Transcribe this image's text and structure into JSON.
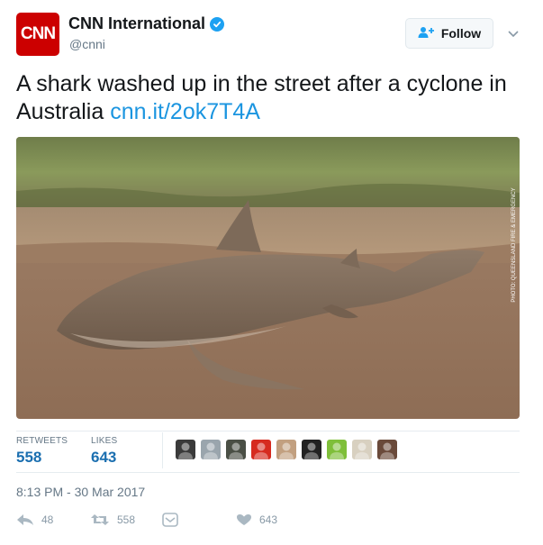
{
  "account": {
    "avatar_text": "CNN",
    "display_name": "CNN International",
    "handle": "@cnni",
    "verified_color": "#1da1f2",
    "brand_color": "#cc0000"
  },
  "follow": {
    "label": "Follow"
  },
  "tweet": {
    "text": "A shark washed up in the street after a cyclone in Australia",
    "link": "cnn.it/2ok7T4A"
  },
  "photo": {
    "credit": "PHOTO: QUEENSLAND FIRE & EMERGENCY",
    "icon": "photo-of-shark-on-muddy-road"
  },
  "stats": {
    "retweets_label": "RETWEETS",
    "retweets_value": "558",
    "likes_label": "LIKES",
    "likes_value": "643"
  },
  "likers": [
    {
      "name": "liker-1",
      "color": "#3a3a3a"
    },
    {
      "name": "liker-2",
      "color": "#9aa5ad"
    },
    {
      "name": "liker-3",
      "color": "#4a4f45"
    },
    {
      "name": "liker-4",
      "color": "#d62b1f"
    },
    {
      "name": "liker-5",
      "color": "#c2a080"
    },
    {
      "name": "liker-6",
      "color": "#222222"
    },
    {
      "name": "liker-7",
      "color": "#7fbf3a"
    },
    {
      "name": "liker-8",
      "color": "#d8d0c0"
    },
    {
      "name": "liker-9",
      "color": "#6a4a3a"
    }
  ],
  "timestamp": "8:13 PM - 30 Mar 2017",
  "actions": {
    "reply_count": "48",
    "retweet_count": "558",
    "like_count": "643"
  },
  "colors": {
    "link": "#1b95e0",
    "muted": "#657786",
    "accent_value": "#1b6fb0"
  }
}
